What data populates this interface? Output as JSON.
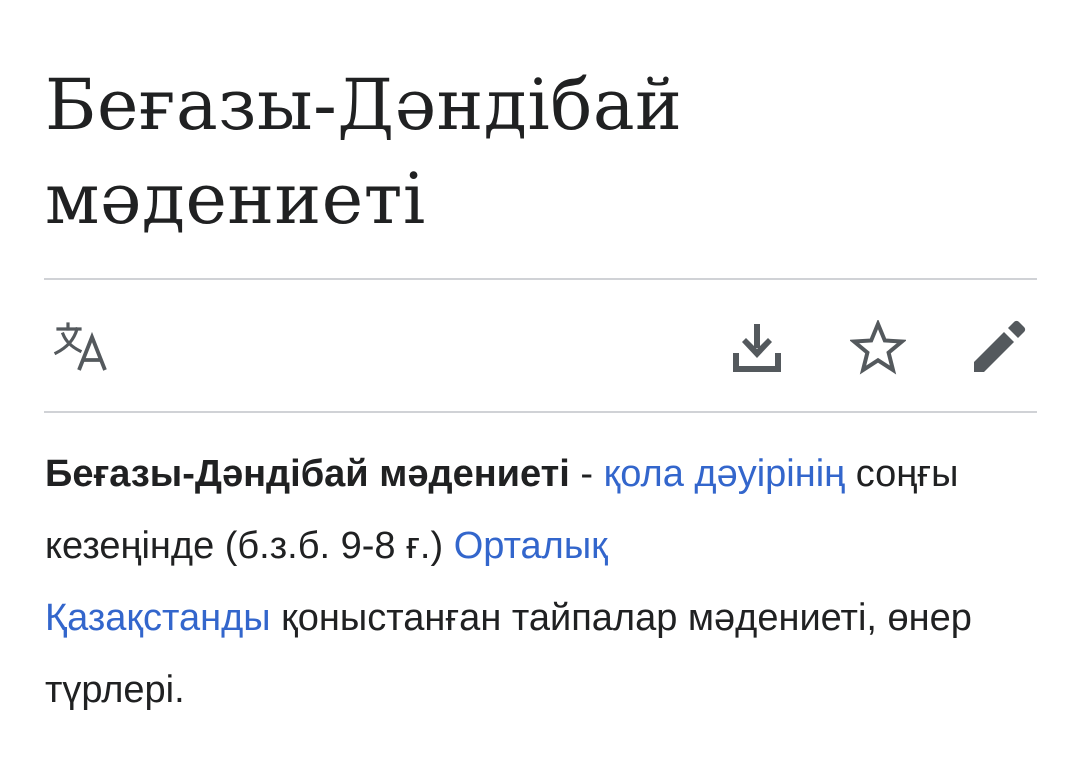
{
  "article": {
    "title_line1": "Беғазы-Дәндібай",
    "title_line2": "мәдениеті",
    "lead": {
      "bold_term": "Беғазы-Дәндібай мәдениеті",
      "separator": " - ",
      "link1": "қола дәуірінің",
      "text1": " соңғы кезеңінде (б.з.б. 9-8 ғ.) ",
      "link2_part1": "Орталық",
      "link2_part2": "Қазақстанды",
      "text2": " қоныстанған тайпалар мәдениеті, өнер түрлері."
    }
  },
  "toolbar": {
    "left": [
      {
        "name": "language",
        "icon": "translate-icon"
      }
    ],
    "right": [
      {
        "name": "download",
        "icon": "download-icon"
      },
      {
        "name": "watch",
        "icon": "star-icon"
      },
      {
        "name": "edit",
        "icon": "pencil-icon"
      }
    ]
  },
  "colors": {
    "text": "#202122",
    "link": "#3366cc",
    "icon": "#54595d",
    "divider": "#d0d2d6",
    "background": "#ffffff"
  }
}
